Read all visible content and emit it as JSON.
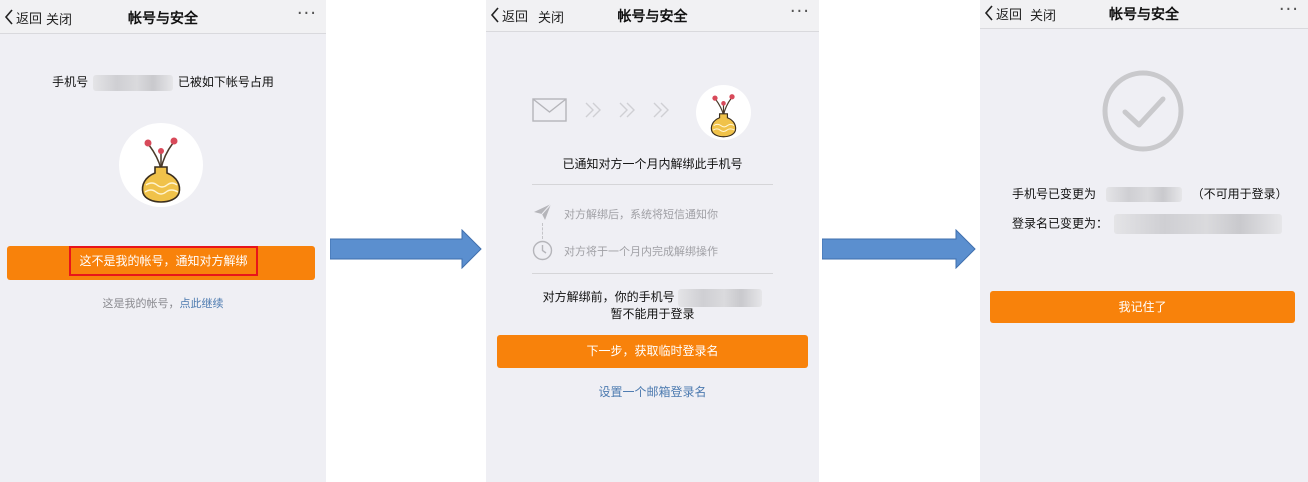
{
  "nav": {
    "back": "返回",
    "close": "关闭",
    "title": "帐号与安全",
    "more": "···"
  },
  "screen1": {
    "phone_prefix": "手机号",
    "phone_suffix": "已被如下帐号占用",
    "notify_button": "这不是我的帐号，通知对方解绑",
    "mine_prefix": "这是我的帐号，",
    "mine_link": "点此继续",
    "highlight_color": "#e8141a"
  },
  "screen2": {
    "notified": "已通知对方一个月内解绑此手机号",
    "step1": "对方解绑后，系统将短信通知你",
    "step2": "对方将于一个月内完成解绑操作",
    "warning_line1": "对方解绑前，你的手机号",
    "warning_line2": "暂不能用于登录",
    "next_button": "下一步，获取临时登录名",
    "email_link": "设置一个邮箱登录名"
  },
  "screen3": {
    "phone_changed": "手机号已变更为",
    "phone_note": "（不可用于登录）",
    "login_changed": "登录名已变更为：",
    "confirm_button": "我记住了"
  },
  "icons": [
    "chevron-left-icon",
    "more-icon",
    "vase-avatar-icon",
    "envelope-icon",
    "double-chevron-icon",
    "paper-plane-icon",
    "clock-icon",
    "check-circle-icon",
    "right-arrow-icon"
  ],
  "colors": {
    "accent": "#f8820b",
    "link": "#4d7bb0",
    "arrow": "#5b8fcf",
    "background": "#efeff4"
  }
}
